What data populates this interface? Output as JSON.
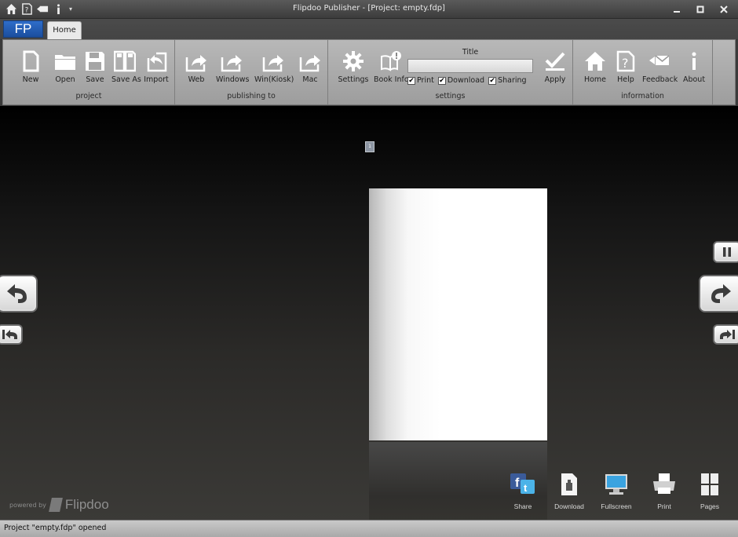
{
  "window": {
    "title": "Flipdoo Publisher - [Project: empty.fdp]",
    "qat_icons": [
      "home-icon",
      "help-icon",
      "feedback-icon",
      "info-icon"
    ],
    "qat_dropdown": "▾"
  },
  "ribbon": {
    "app_button": "FP",
    "tabs": [
      {
        "label": "Home"
      }
    ],
    "groups": {
      "project": {
        "label": "project",
        "buttons": [
          {
            "label": "New",
            "icon": "new-document-icon"
          },
          {
            "label": "Open",
            "icon": "open-folder-icon"
          },
          {
            "label": "Save",
            "icon": "save-icon"
          },
          {
            "label": "Save As",
            "icon": "save-as-icon"
          },
          {
            "label": "Import",
            "icon": "import-icon"
          }
        ]
      },
      "publishing": {
        "label": "publishing to",
        "buttons": [
          {
            "label": "Web",
            "icon": "publish-web-icon"
          },
          {
            "label": "Windows",
            "icon": "publish-windows-icon"
          },
          {
            "label": "Win(Kiosk)",
            "icon": "publish-kiosk-icon"
          },
          {
            "label": "Mac",
            "icon": "publish-mac-icon"
          }
        ]
      },
      "settings": {
        "label": "settings",
        "buttons": [
          {
            "label": "Settings",
            "icon": "gear-icon"
          },
          {
            "label": "Book Info",
            "icon": "book-info-icon"
          },
          {
            "label": "Apply",
            "icon": "apply-icon"
          }
        ],
        "title_label": "Title",
        "title_value": "",
        "checkboxes": [
          {
            "label": "Print",
            "checked": true
          },
          {
            "label": "Download",
            "checked": true
          },
          {
            "label": "Sharing",
            "checked": true
          }
        ]
      },
      "information": {
        "label": "information",
        "buttons": [
          {
            "label": "Home",
            "icon": "home-icon"
          },
          {
            "label": "Help",
            "icon": "help-icon"
          },
          {
            "label": "Feedback",
            "icon": "feedback-icon"
          },
          {
            "label": "About",
            "icon": "info-icon"
          }
        ]
      }
    }
  },
  "viewer": {
    "page_number": "1",
    "powered_by": "powered by",
    "brand": "Flipdoo",
    "toolbar": [
      {
        "label": "Share",
        "icon": "share-social-icon"
      },
      {
        "label": "Download",
        "icon": "download-icon"
      },
      {
        "label": "Fullscreen",
        "icon": "fullscreen-monitor-icon"
      },
      {
        "label": "Print",
        "icon": "printer-icon"
      },
      {
        "label": "Pages",
        "icon": "pages-icon"
      }
    ]
  },
  "status": {
    "text": "Project \"empty.fdp\" opened"
  }
}
